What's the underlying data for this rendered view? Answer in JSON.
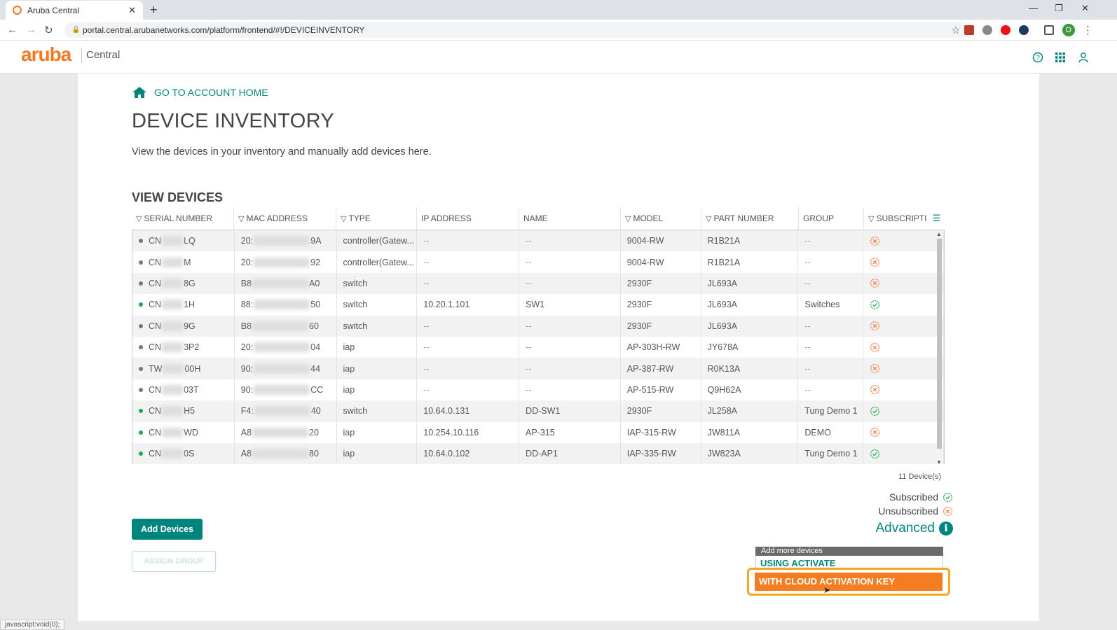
{
  "browser": {
    "tab_title": "Aruba Central",
    "url": "portal.central.arubanetworks.com/platform/frontend/#!/DEVICEINVENTORY",
    "status_text": "javascript:void(0);"
  },
  "header": {
    "logo": "aruba",
    "product": "Central"
  },
  "page": {
    "home_link": "GO TO ACCOUNT HOME",
    "title": "DEVICE INVENTORY",
    "description": "View the devices in your inventory and manually add devices here.",
    "section_title": "VIEW DEVICES"
  },
  "table": {
    "columns": [
      "SERIAL NUMBER",
      "MAC ADDRESS",
      "TYPE",
      "IP ADDRESS",
      "NAME",
      "MODEL",
      "PART NUMBER",
      "GROUP",
      "SUBSCRIPTI"
    ],
    "rows": [
      {
        "status": "offline",
        "serial_prefix": "CN",
        "serial_suffix": "LQ",
        "mac_prefix": "20:",
        "mac_suffix": "9A",
        "type": "controller(Gatew...",
        "ip": "--",
        "name": "--",
        "model": "9004-RW",
        "part": "R1B21A",
        "group": "--",
        "subscribed": false
      },
      {
        "status": "offline",
        "serial_prefix": "CN",
        "serial_suffix": "M",
        "mac_prefix": "20:",
        "mac_suffix": "92",
        "type": "controller(Gatew...",
        "ip": "--",
        "name": "--",
        "model": "9004-RW",
        "part": "R1B21A",
        "group": "--",
        "subscribed": false
      },
      {
        "status": "offline",
        "serial_prefix": "CN",
        "serial_suffix": "8G",
        "mac_prefix": "B8",
        "mac_suffix": "A0",
        "type": "switch",
        "ip": "--",
        "name": "--",
        "model": "2930F",
        "part": "JL693A",
        "group": "--",
        "subscribed": false
      },
      {
        "status": "online",
        "serial_prefix": "CN",
        "serial_suffix": "1H",
        "mac_prefix": "88:",
        "mac_suffix": "50",
        "type": "switch",
        "ip": "10.20.1.101",
        "name": "SW1",
        "model": "2930F",
        "part": "JL693A",
        "group": "Switches",
        "subscribed": true
      },
      {
        "status": "offline",
        "serial_prefix": "CN",
        "serial_suffix": "9G",
        "mac_prefix": "B8",
        "mac_suffix": "60",
        "type": "switch",
        "ip": "--",
        "name": "--",
        "model": "2930F",
        "part": "JL693A",
        "group": "--",
        "subscribed": false
      },
      {
        "status": "offline",
        "serial_prefix": "CN",
        "serial_suffix": "3P2",
        "mac_prefix": "20:",
        "mac_suffix": "04",
        "type": "iap",
        "ip": "--",
        "name": "--",
        "model": "AP-303H-RW",
        "part": "JY678A",
        "group": "--",
        "subscribed": false
      },
      {
        "status": "offline",
        "serial_prefix": "TW",
        "serial_suffix": "00H",
        "mac_prefix": "90:",
        "mac_suffix": "44",
        "type": "iap",
        "ip": "--",
        "name": "--",
        "model": "AP-387-RW",
        "part": "R0K13A",
        "group": "--",
        "subscribed": false
      },
      {
        "status": "offline",
        "serial_prefix": "CN",
        "serial_suffix": "03T",
        "mac_prefix": "90:",
        "mac_suffix": "CC",
        "type": "iap",
        "ip": "--",
        "name": "--",
        "model": "AP-515-RW",
        "part": "Q9H62A",
        "group": "--",
        "subscribed": false
      },
      {
        "status": "online",
        "serial_prefix": "CN",
        "serial_suffix": "H5",
        "mac_prefix": "F4:",
        "mac_suffix": "40",
        "type": "switch",
        "ip": "10.64.0.131",
        "name": "DD-SW1",
        "model": "2930F",
        "part": "JL258A",
        "group": "Tung Demo 1",
        "subscribed": true
      },
      {
        "status": "online",
        "serial_prefix": "CN",
        "serial_suffix": "WD",
        "mac_prefix": "A8",
        "mac_suffix": "20",
        "type": "iap",
        "ip": "10.254.10.116",
        "name": "AP-315",
        "model": "IAP-315-RW",
        "part": "JW811A",
        "group": "DEMO",
        "subscribed": false
      },
      {
        "status": "online",
        "serial_prefix": "CN",
        "serial_suffix": "0S",
        "mac_prefix": "A8",
        "mac_suffix": "80",
        "type": "iap",
        "ip": "10.64.0.102",
        "name": "DD-AP1",
        "model": "IAP-335-RW",
        "part": "JW823A",
        "group": "Tung Demo 1",
        "subscribed": true
      }
    ],
    "count": "11 Device(s)"
  },
  "legend": {
    "subscribed": "Subscribed",
    "unsubscribed": "Unsubscribed"
  },
  "advanced": {
    "label": "Advanced",
    "dropdown_header": "Add more devices",
    "option_activate": "USING ACTIVATE",
    "option_cloud_key": "WITH CLOUD ACTIVATION KEY"
  },
  "buttons": {
    "add_devices": "Add Devices",
    "assign_group": "ASSIGN GROUP"
  },
  "colors": {
    "brand_teal": "#00857d",
    "brand_orange": "#f47920",
    "highlight_orange": "#f57c1f",
    "subscribed_green": "#1fa64a",
    "unsubscribed_orange": "#f07b45"
  }
}
